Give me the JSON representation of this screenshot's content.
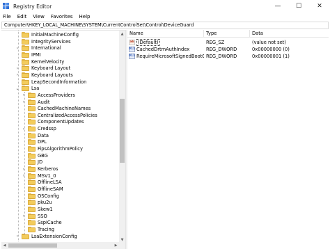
{
  "window": {
    "title": "Registry Editor",
    "controls": {
      "minimize": "—",
      "maximize": "☐",
      "close": "✕"
    }
  },
  "menu": [
    "File",
    "Edit",
    "View",
    "Favorites",
    "Help"
  ],
  "address": "Computer\\HKEY_LOCAL_MACHINE\\SYSTEM\\CurrentControlSet\\Control\\DeviceGuard",
  "tree": {
    "items": [
      {
        "label": "InitialMachineConfig",
        "depth": 0,
        "expander": ""
      },
      {
        "label": "IntegrityServices",
        "depth": 0,
        "expander": ""
      },
      {
        "label": "International",
        "depth": 0,
        "expander": ">"
      },
      {
        "label": "IPMI",
        "depth": 0,
        "expander": ""
      },
      {
        "label": "KernelVelocity",
        "depth": 0,
        "expander": ""
      },
      {
        "label": "Keyboard Layout",
        "depth": 0,
        "expander": ">"
      },
      {
        "label": "Keyboard Layouts",
        "depth": 0,
        "expander": ">"
      },
      {
        "label": "LeapSecondInformation",
        "depth": 0,
        "expander": ""
      },
      {
        "label": "Lsa",
        "depth": 0,
        "expander": "v"
      },
      {
        "label": "AccessProviders",
        "depth": 1,
        "expander": ">"
      },
      {
        "label": "Audit",
        "depth": 1,
        "expander": ">"
      },
      {
        "label": "CachedMachineNames",
        "depth": 1,
        "expander": ""
      },
      {
        "label": "CentralizedAccessPolicies",
        "depth": 1,
        "expander": ""
      },
      {
        "label": "ComponentUpdates",
        "depth": 1,
        "expander": ""
      },
      {
        "label": "Credssp",
        "depth": 1,
        "expander": ">"
      },
      {
        "label": "Data",
        "depth": 1,
        "expander": ""
      },
      {
        "label": "DPL",
        "depth": 1,
        "expander": ""
      },
      {
        "label": "FipsAlgorithmPolicy",
        "depth": 1,
        "expander": ""
      },
      {
        "label": "GBG",
        "depth": 1,
        "expander": ""
      },
      {
        "label": "JD",
        "depth": 1,
        "expander": ""
      },
      {
        "label": "Kerberos",
        "depth": 1,
        "expander": ">"
      },
      {
        "label": "MSV1_0",
        "depth": 1,
        "expander": ">"
      },
      {
        "label": "OfflineLSA",
        "depth": 1,
        "expander": ""
      },
      {
        "label": "OfflineSAM",
        "depth": 1,
        "expander": ""
      },
      {
        "label": "OSConfig",
        "depth": 1,
        "expander": ""
      },
      {
        "label": "pku2u",
        "depth": 1,
        "expander": ""
      },
      {
        "label": "Skew1",
        "depth": 1,
        "expander": ""
      },
      {
        "label": "SSO",
        "depth": 1,
        "expander": ">"
      },
      {
        "label": "SspiCache",
        "depth": 1,
        "expander": ""
      },
      {
        "label": "Tracing",
        "depth": 1,
        "expander": ""
      },
      {
        "label": "LsaExtensionConfig",
        "depth": 0,
        "expander": ">"
      }
    ]
  },
  "list": {
    "headers": {
      "name": "Name",
      "type": "Type",
      "data": "Data"
    },
    "rows": [
      {
        "name": "(Default)",
        "type": "REG_SZ",
        "data": "(value not set)",
        "icon": "ab",
        "icon_name": "string-value-icon"
      },
      {
        "name": "CachedDrtmAuthIndex",
        "type": "REG_DWORD",
        "data": "0x00000000 (0)",
        "icon": "011",
        "icon_name": "dword-value-icon"
      },
      {
        "name": "RequireMicrosoftSignedBootCh...",
        "type": "REG_DWORD",
        "data": "0x00000001 (1)",
        "icon": "011",
        "icon_name": "dword-value-icon"
      }
    ]
  },
  "colors": {
    "folder": "#f3cc5c",
    "accent": "#2f6fd6"
  }
}
